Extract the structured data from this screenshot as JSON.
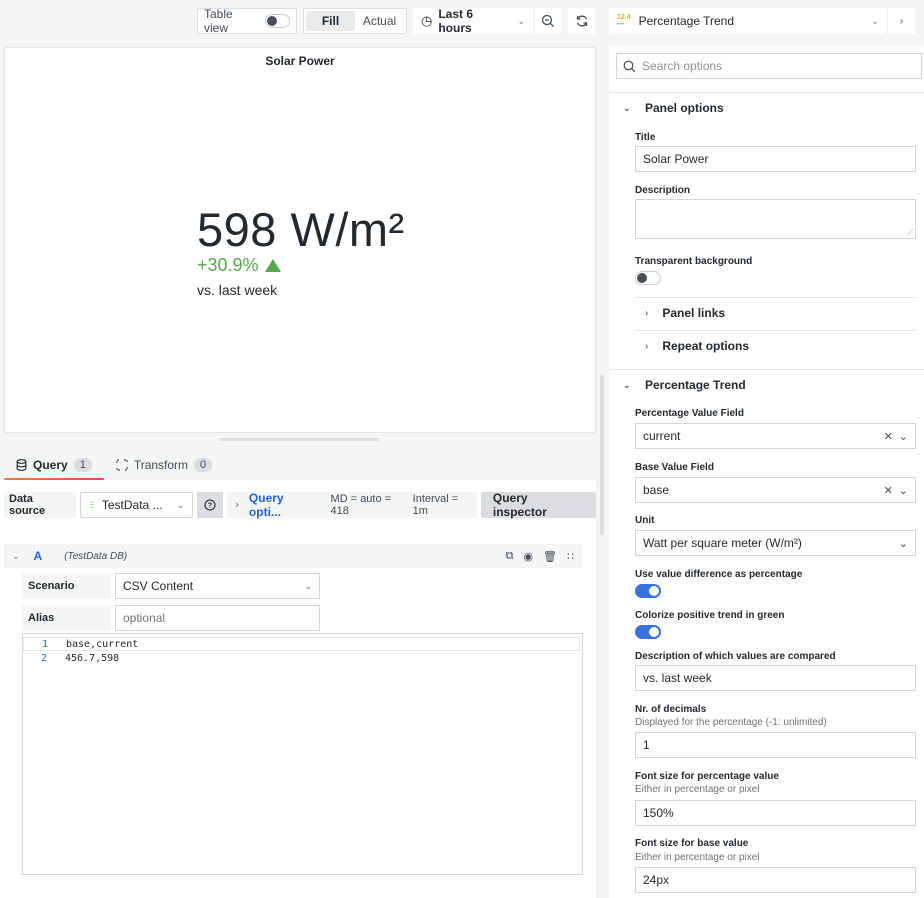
{
  "toolbar": {
    "table_view_label": "Table view",
    "table_view_on": false,
    "fill_label": "Fill",
    "actual_label": "Actual",
    "time_range": "Last 6 hours",
    "zoom_out_icon": "zoom-out-icon",
    "refresh_icon": "refresh-icon"
  },
  "viz_picker": {
    "name": "Percentage Trend",
    "icon": "percentage-trend-icon"
  },
  "panel": {
    "title": "Solar Power",
    "value": "598 W/m²",
    "percentage": "+30.9%",
    "comparison": "vs. last week",
    "trend_color": "#56a64b"
  },
  "query_tabs": [
    {
      "label": "Query",
      "count": "1",
      "active": true
    },
    {
      "label": "Transform",
      "count": "0",
      "active": false
    }
  ],
  "query_bar": {
    "datasource_label": "Data source",
    "datasource_value": "TestData ...",
    "query_options_label": "Query opti...",
    "md": "MD = auto = 418",
    "interval": "Interval = 1m",
    "inspector_label": "Query inspector"
  },
  "query": {
    "ref_id": "A",
    "datasource": "(TestData DB)",
    "scenario_label": "Scenario",
    "scenario_value": "CSV Content",
    "alias_label": "Alias",
    "alias_placeholder": "optional",
    "code_lines": [
      {
        "n": "1",
        "text": "base,current"
      },
      {
        "n": "2",
        "text": "456.7,598"
      }
    ]
  },
  "options": {
    "search_placeholder": "Search options",
    "panel_options": {
      "header": "Panel options",
      "title_label": "Title",
      "title_value": "Solar Power",
      "description_label": "Description",
      "description_value": "",
      "transparent_label": "Transparent background",
      "transparent_on": false,
      "panel_links": "Panel links",
      "repeat_options": "Repeat options"
    },
    "trend": {
      "header": "Percentage Trend",
      "pct_field_label": "Percentage Value Field",
      "pct_field_value": "current",
      "base_field_label": "Base Value Field",
      "base_field_value": "base",
      "unit_label": "Unit",
      "unit_value": "Watt per square meter (W/m²)",
      "use_diff_label": "Use value difference as percentage",
      "use_diff_on": true,
      "colorize_label": "Colorize positive trend in green",
      "colorize_on": true,
      "compare_desc_label": "Description of which values are compared",
      "compare_desc_value": "vs. last week",
      "decimals_label": "Nr. of decimals",
      "decimals_desc": "Displayed for the percentage (-1: unlimited)",
      "decimals_value": "1",
      "pct_font_label": "Font size for percentage value",
      "pct_font_desc": "Either in percentage or pixel",
      "pct_font_value": "150%",
      "base_font_label": "Font size for base value",
      "base_font_desc": "Either in percentage or pixel",
      "base_font_value": "24px"
    }
  }
}
